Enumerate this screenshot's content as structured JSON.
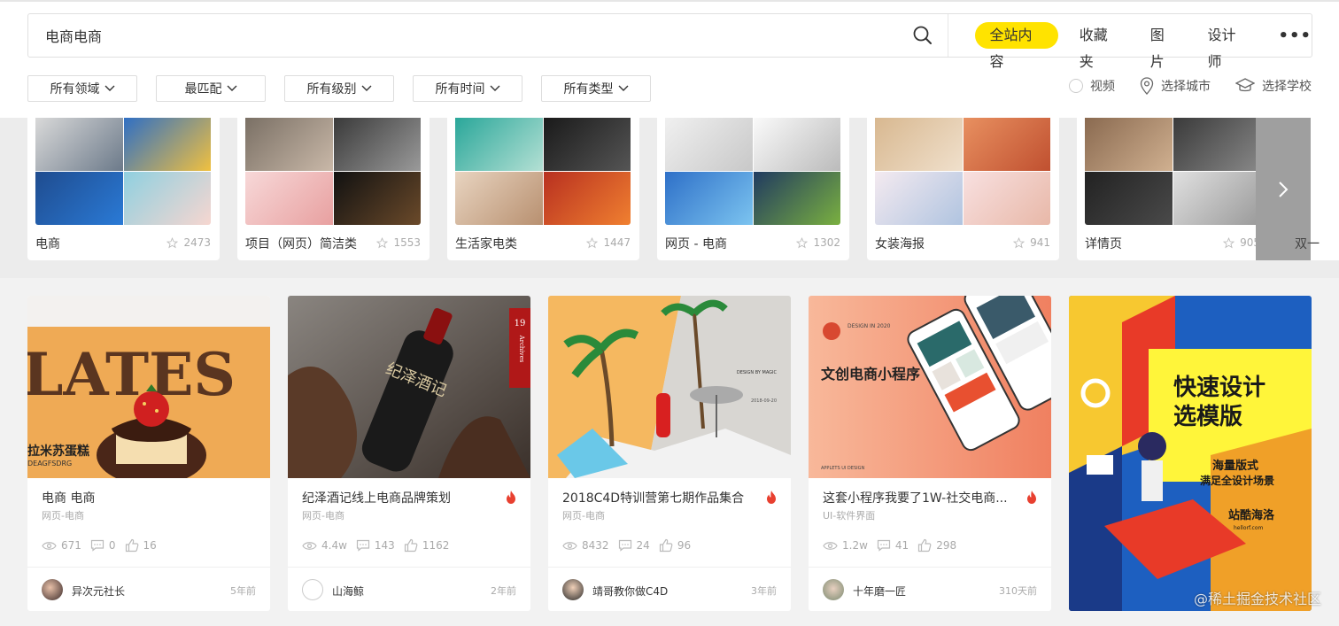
{
  "search": {
    "query": "电商电商",
    "scopes": [
      {
        "label": "全站内容",
        "active": true
      },
      {
        "label": "收藏夹",
        "active": false
      },
      {
        "label": "图片",
        "active": false
      },
      {
        "label": "设计师",
        "active": false
      }
    ],
    "more": "•••"
  },
  "filters": [
    "所有领域",
    "最匹配",
    "所有级别",
    "所有时间",
    "所有类型"
  ],
  "options": {
    "video": "视频",
    "city": "选择城市",
    "school": "选择学校"
  },
  "topics": [
    {
      "name": "电商",
      "count": "2473"
    },
    {
      "name": "项目（网页）简洁类",
      "count": "1553"
    },
    {
      "name": "生活家电类",
      "count": "1447"
    },
    {
      "name": "网页 - 电商",
      "count": "1302"
    },
    {
      "name": "女装海报",
      "count": "941"
    },
    {
      "name": "详情页",
      "count": "905"
    },
    {
      "name": "双一"
    }
  ],
  "cards": [
    {
      "title": "电商 电商",
      "category": "网页-电商",
      "hot": false,
      "views": "671",
      "comments": "0",
      "likes": "16",
      "author": "异次元社长",
      "ago": "5年前",
      "image_text": {
        "big": "LATES",
        "sub": "拉米苏蛋糕",
        "sub2": "DEAGFSDRG"
      }
    },
    {
      "title": "纪泽酒记线上电商品牌策划",
      "category": "网页-电商",
      "hot": true,
      "views": "4.4w",
      "comments": "143",
      "likes": "1162",
      "author": "山海鲸",
      "ago": "2年前",
      "image_text": {
        "bottle": "纪泽酒记",
        "tag": "19",
        "tag2": "Archives"
      }
    },
    {
      "title": "2018C4D特训营第七期作品集合",
      "category": "网页-电商",
      "hot": true,
      "views": "8432",
      "comments": "24",
      "likes": "96",
      "author": "靖哥教你做C4D",
      "ago": "3年前",
      "image_text": {
        "design": "DESIGN BY MAGIC",
        "date": "2018-09-20"
      }
    },
    {
      "title": "这套小程序我要了1W-社交电商...",
      "category": "UI-软件界面",
      "hot": true,
      "views": "1.2w",
      "comments": "41",
      "likes": "298",
      "author": "十年磨一匠",
      "ago": "310天前",
      "image_text": {
        "head": "DESIGN IN 2020",
        "title": "文创电商小程序",
        "foot": "APPLETS UI DESIGN"
      }
    }
  ],
  "poster": {
    "line1": "快速设计",
    "line2": "选模版",
    "sub1": "海量版式",
    "sub2": "满足全设计场景",
    "brand": "站酷海洛",
    "brand_en": "hellorf.com"
  },
  "watermark": "@稀土掘金技术社区"
}
